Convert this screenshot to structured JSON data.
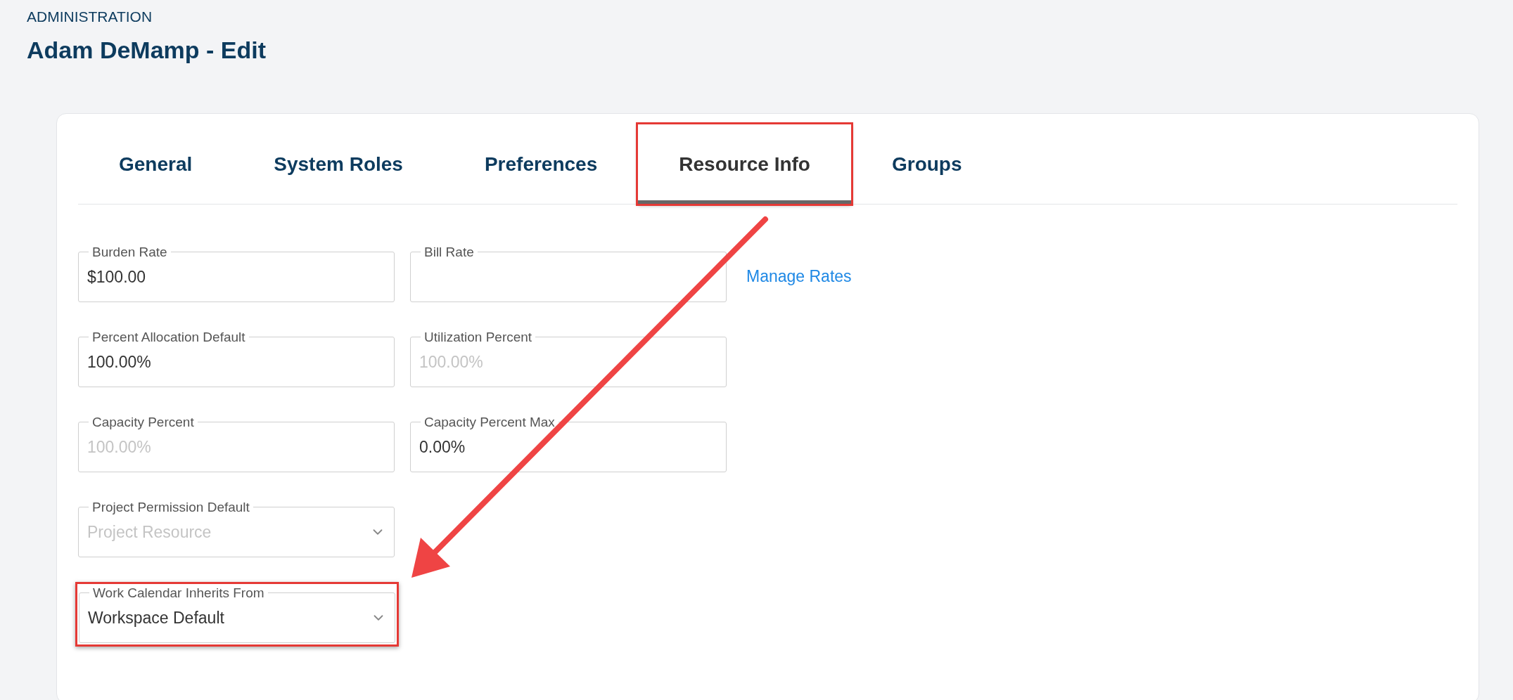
{
  "breadcrumb": "ADMINISTRATION",
  "title": "Adam DeMamp - Edit",
  "tabs": [
    {
      "label": "General",
      "selected": false,
      "highlighted": false
    },
    {
      "label": "System Roles",
      "selected": false,
      "highlighted": false
    },
    {
      "label": "Preferences",
      "selected": false,
      "highlighted": false
    },
    {
      "label": "Resource Info",
      "selected": true,
      "highlighted": true
    },
    {
      "label": "Groups",
      "selected": false,
      "highlighted": false
    }
  ],
  "rows": [
    {
      "fields": [
        {
          "kind": "text",
          "label": "Burden Rate",
          "value": "$100.00",
          "disabled": false,
          "highlighted": false
        },
        {
          "kind": "text",
          "label": "Bill Rate",
          "disabled": false,
          "highlighted": false
        }
      ],
      "link": "Manage Rates"
    },
    {
      "fields": [
        {
          "kind": "text",
          "label": "Percent Allocation Default",
          "value": "100.00%",
          "disabled": false,
          "highlighted": false
        },
        {
          "kind": "text",
          "label": "Utilization Percent",
          "value": "100.00%",
          "disabled": true,
          "highlighted": false
        }
      ]
    },
    {
      "fields": [
        {
          "kind": "text",
          "label": "Capacity Percent",
          "value": "100.00%",
          "disabled": true,
          "highlighted": false
        },
        {
          "kind": "text",
          "label": "Capacity Percent Max",
          "value": "0.00%",
          "disabled": false,
          "highlighted": false
        }
      ]
    },
    {
      "fields": [
        {
          "kind": "select",
          "label": "Project Permission Default",
          "value": "Project Resource",
          "disabled": true,
          "highlighted": false
        }
      ]
    },
    {
      "fields": [
        {
          "kind": "select",
          "label": "Work Calendar Inherits From",
          "value": "Workspace Default",
          "disabled": false,
          "highlighted": true
        }
      ]
    }
  ]
}
